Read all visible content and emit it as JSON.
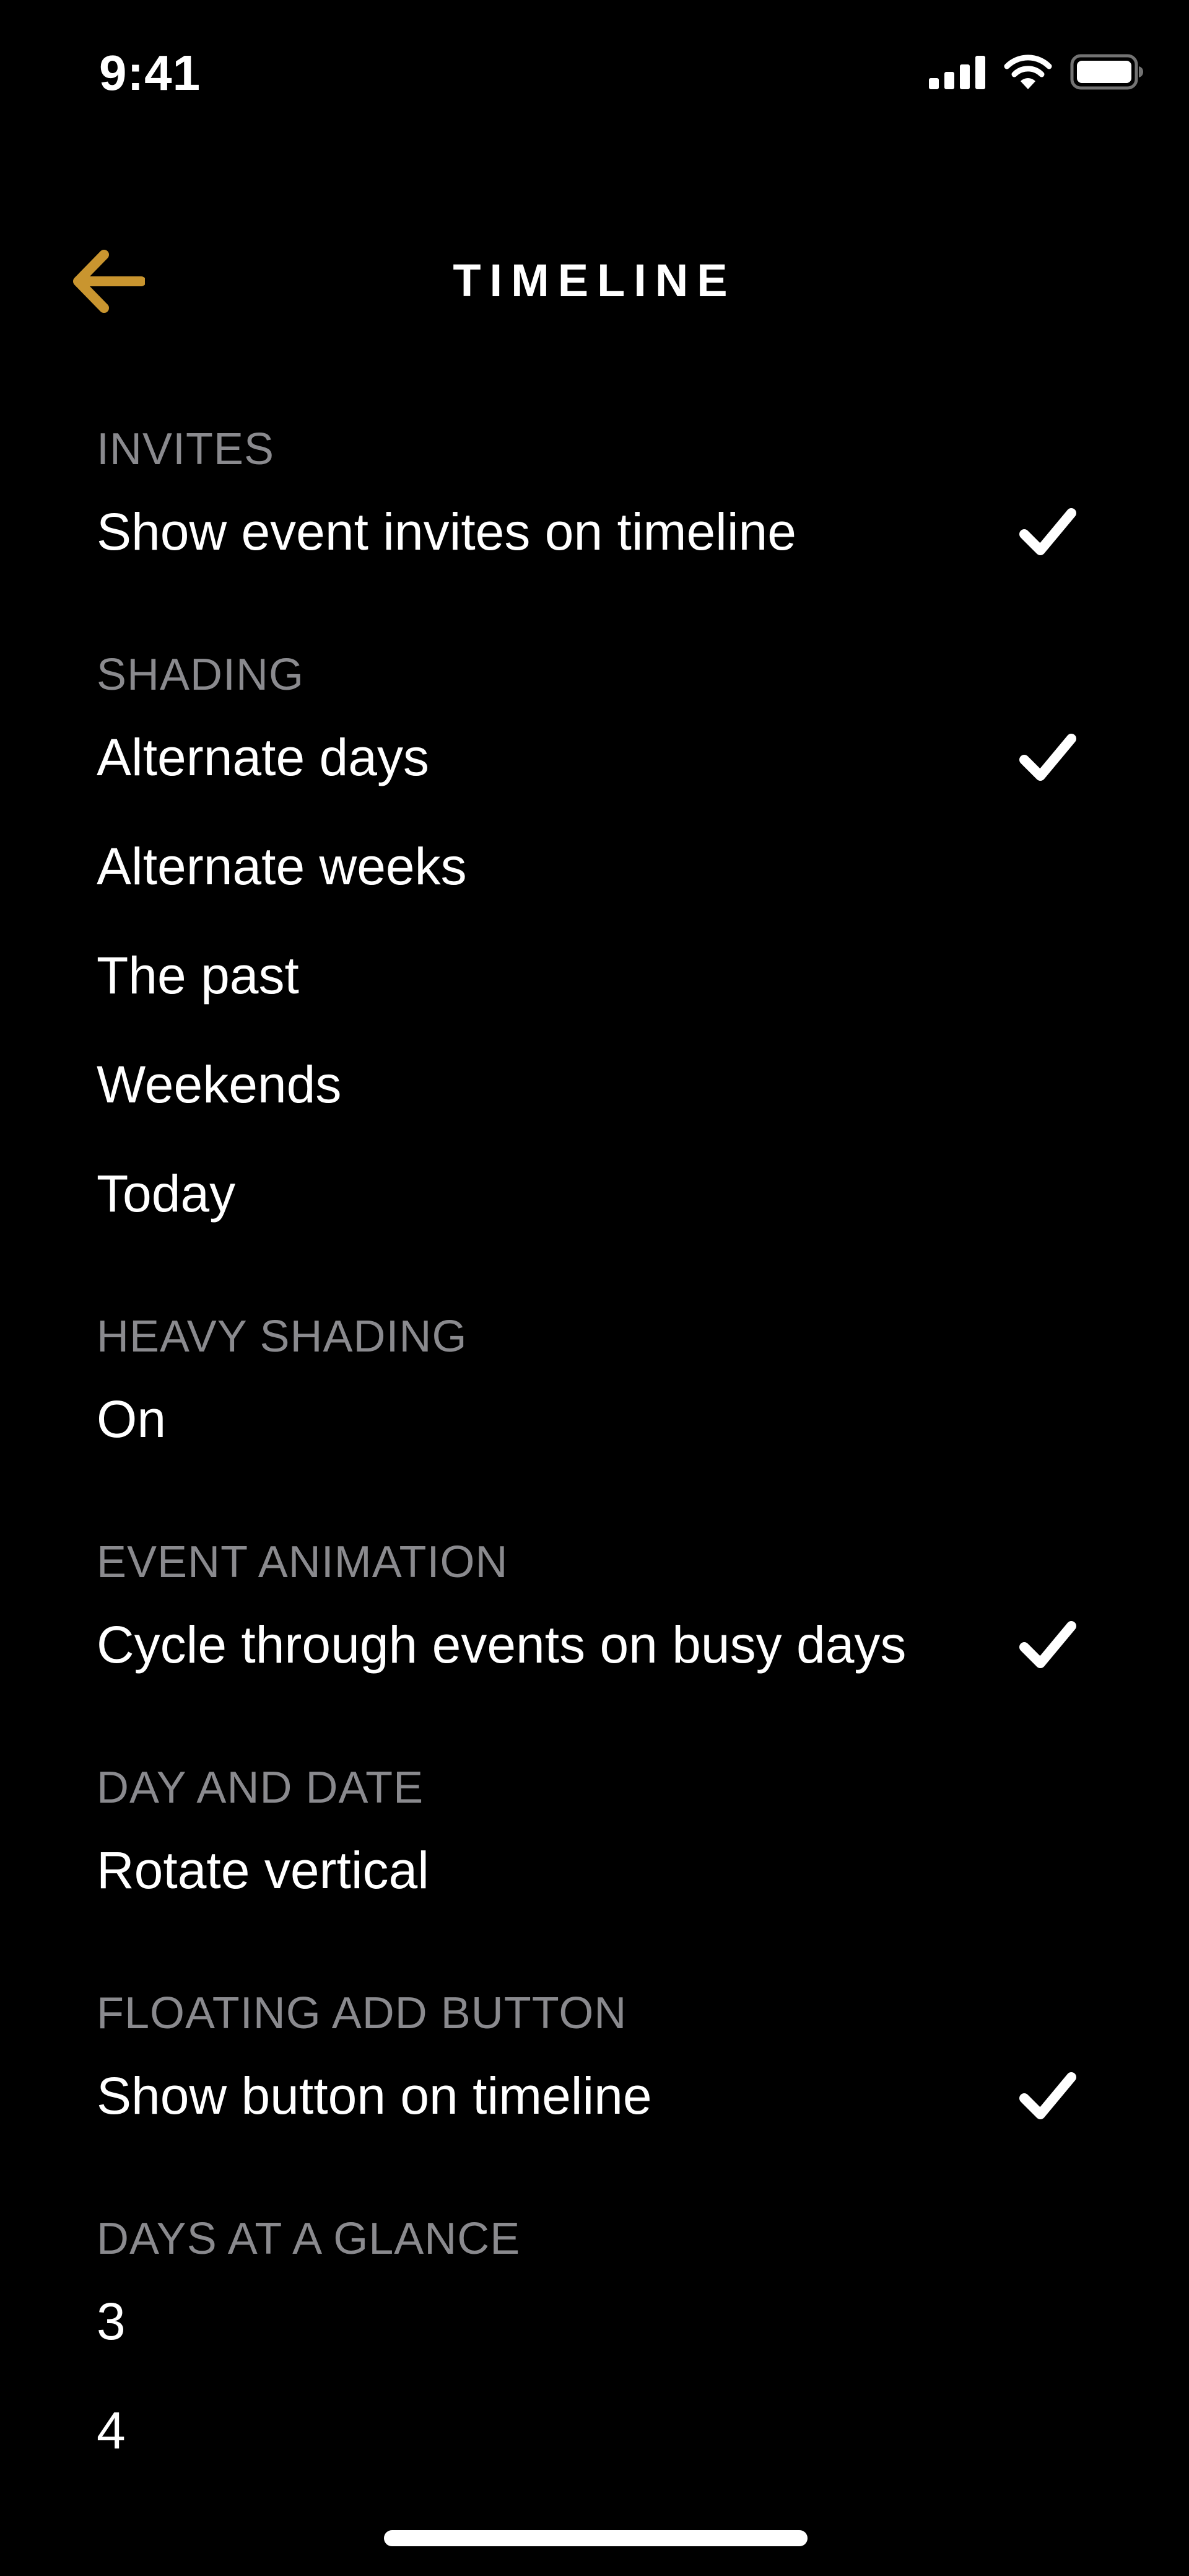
{
  "status_bar": {
    "time": "9:41",
    "icons": [
      "cellular-signal-icon",
      "wifi-icon",
      "battery-icon"
    ]
  },
  "nav": {
    "back_icon": "arrow-left-icon",
    "title": "TIMELINE"
  },
  "colors": {
    "background": "#000000",
    "accent": "#c9952f",
    "section_header": "#8a8a8e",
    "text": "#ffffff"
  },
  "sections": [
    {
      "header": "INVITES",
      "options": [
        {
          "label": "Show event invites on timeline",
          "checked": true
        }
      ]
    },
    {
      "header": "SHADING",
      "options": [
        {
          "label": "Alternate days",
          "checked": true
        },
        {
          "label": "Alternate weeks",
          "checked": false
        },
        {
          "label": "The past",
          "checked": false
        },
        {
          "label": "Weekends",
          "checked": false
        },
        {
          "label": "Today",
          "checked": false
        }
      ]
    },
    {
      "header": "HEAVY SHADING",
      "options": [
        {
          "label": "On",
          "checked": false
        }
      ]
    },
    {
      "header": "EVENT ANIMATION",
      "options": [
        {
          "label": "Cycle through events on busy days",
          "checked": true
        }
      ]
    },
    {
      "header": "DAY AND DATE",
      "options": [
        {
          "label": "Rotate vertical",
          "checked": false
        }
      ]
    },
    {
      "header": "FLOATING ADD BUTTON",
      "options": [
        {
          "label": "Show button on timeline",
          "checked": true
        }
      ]
    },
    {
      "header": "DAYS AT A GLANCE",
      "options": [
        {
          "label": "3",
          "checked": false
        },
        {
          "label": "4",
          "checked": false
        }
      ]
    }
  ]
}
